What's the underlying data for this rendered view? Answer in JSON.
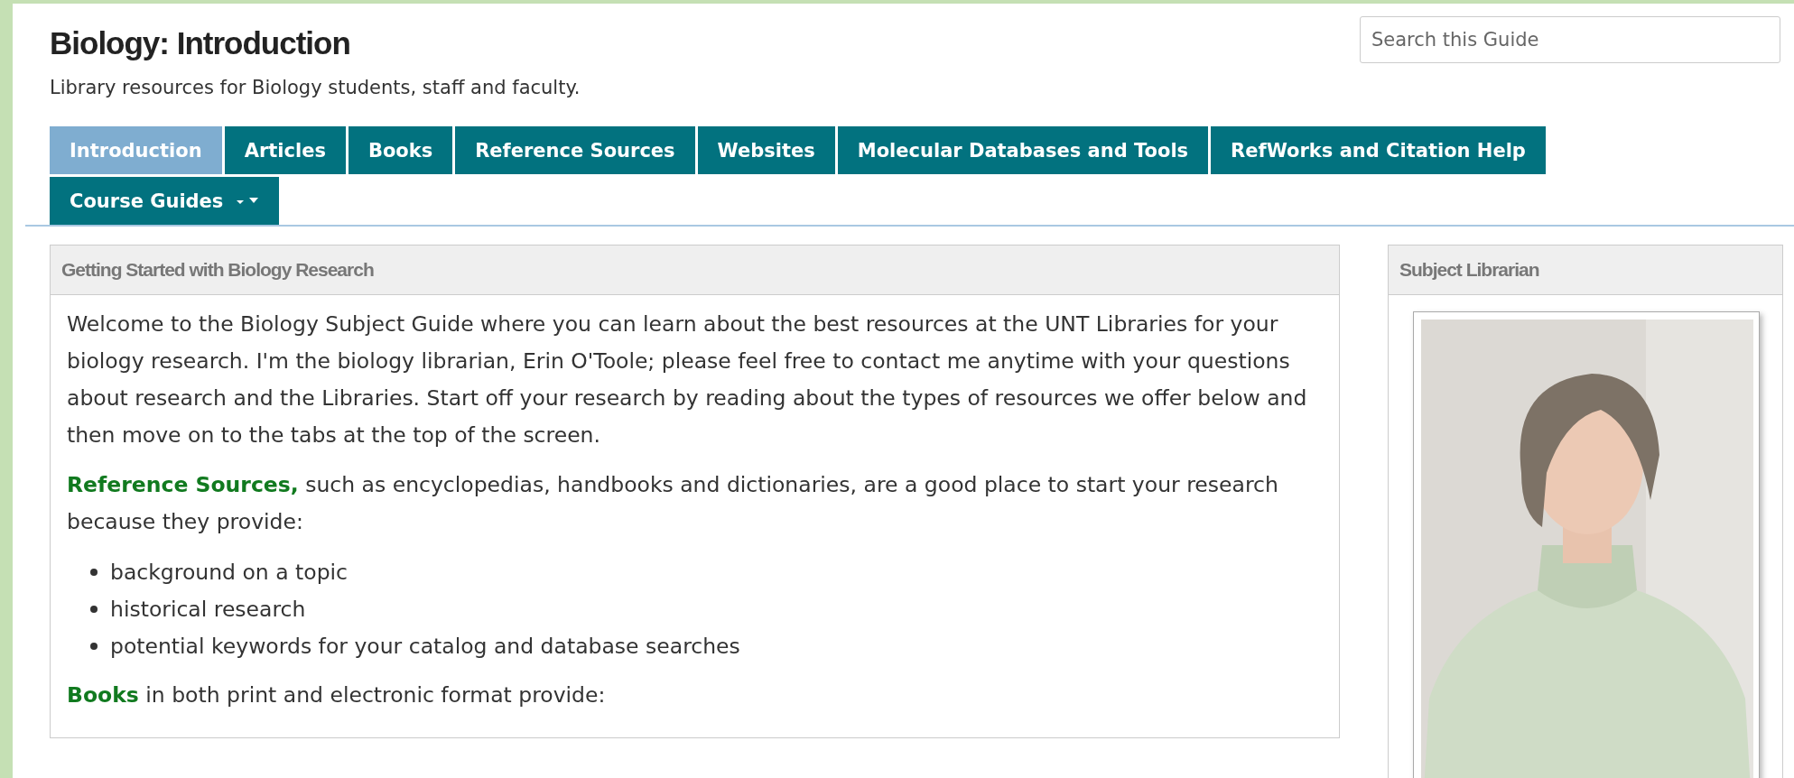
{
  "header": {
    "title": "Biology: Introduction",
    "subtitle": "Library resources for Biology students, staff and faculty."
  },
  "search": {
    "placeholder": "Search this Guide"
  },
  "tabs": [
    {
      "label": "Introduction",
      "selected": true,
      "kind": "plain"
    },
    {
      "label": "Articles",
      "selected": false,
      "kind": "plain"
    },
    {
      "label": "Books",
      "selected": false,
      "kind": "plain"
    },
    {
      "label": "Reference Sources",
      "selected": false,
      "kind": "plain"
    },
    {
      "label": "Websites",
      "selected": false,
      "kind": "plain"
    },
    {
      "label": "Molecular Databases and Tools",
      "selected": false,
      "kind": "plain"
    },
    {
      "label": "RefWorks and Citation Help",
      "selected": false,
      "kind": "plain"
    },
    {
      "label": "Course Guides",
      "selected": false,
      "kind": "dropdown"
    }
  ],
  "main_box": {
    "title": "Getting Started with Biology Research",
    "content": [
      {
        "kind": "paragraph",
        "text": "Welcome to the Biology Subject Guide where you can learn about the best resources at the UNT Libraries for your biology research. I'm the biology librarian, Erin O'Toole; please feel free to contact me anytime with your questions about research and the Libraries. Start off your research by reading about the types of resources we offer below and then move on to the tabs at the top of the screen."
      },
      {
        "kind": "paragraph",
        "text": "**Reference Sources,** such as encyclopedias, handbooks and dictionaries, are a good place to start your research because they provide:"
      },
      {
        "kind": "list",
        "items": [
          "background on a topic",
          "historical research",
          "potential keywords for your catalog and database searches"
        ]
      },
      {
        "kind": "paragraph",
        "text": "**Books** in both print and electronic format provide:"
      }
    ]
  },
  "side_box": {
    "title": "Subject Librarian"
  }
}
